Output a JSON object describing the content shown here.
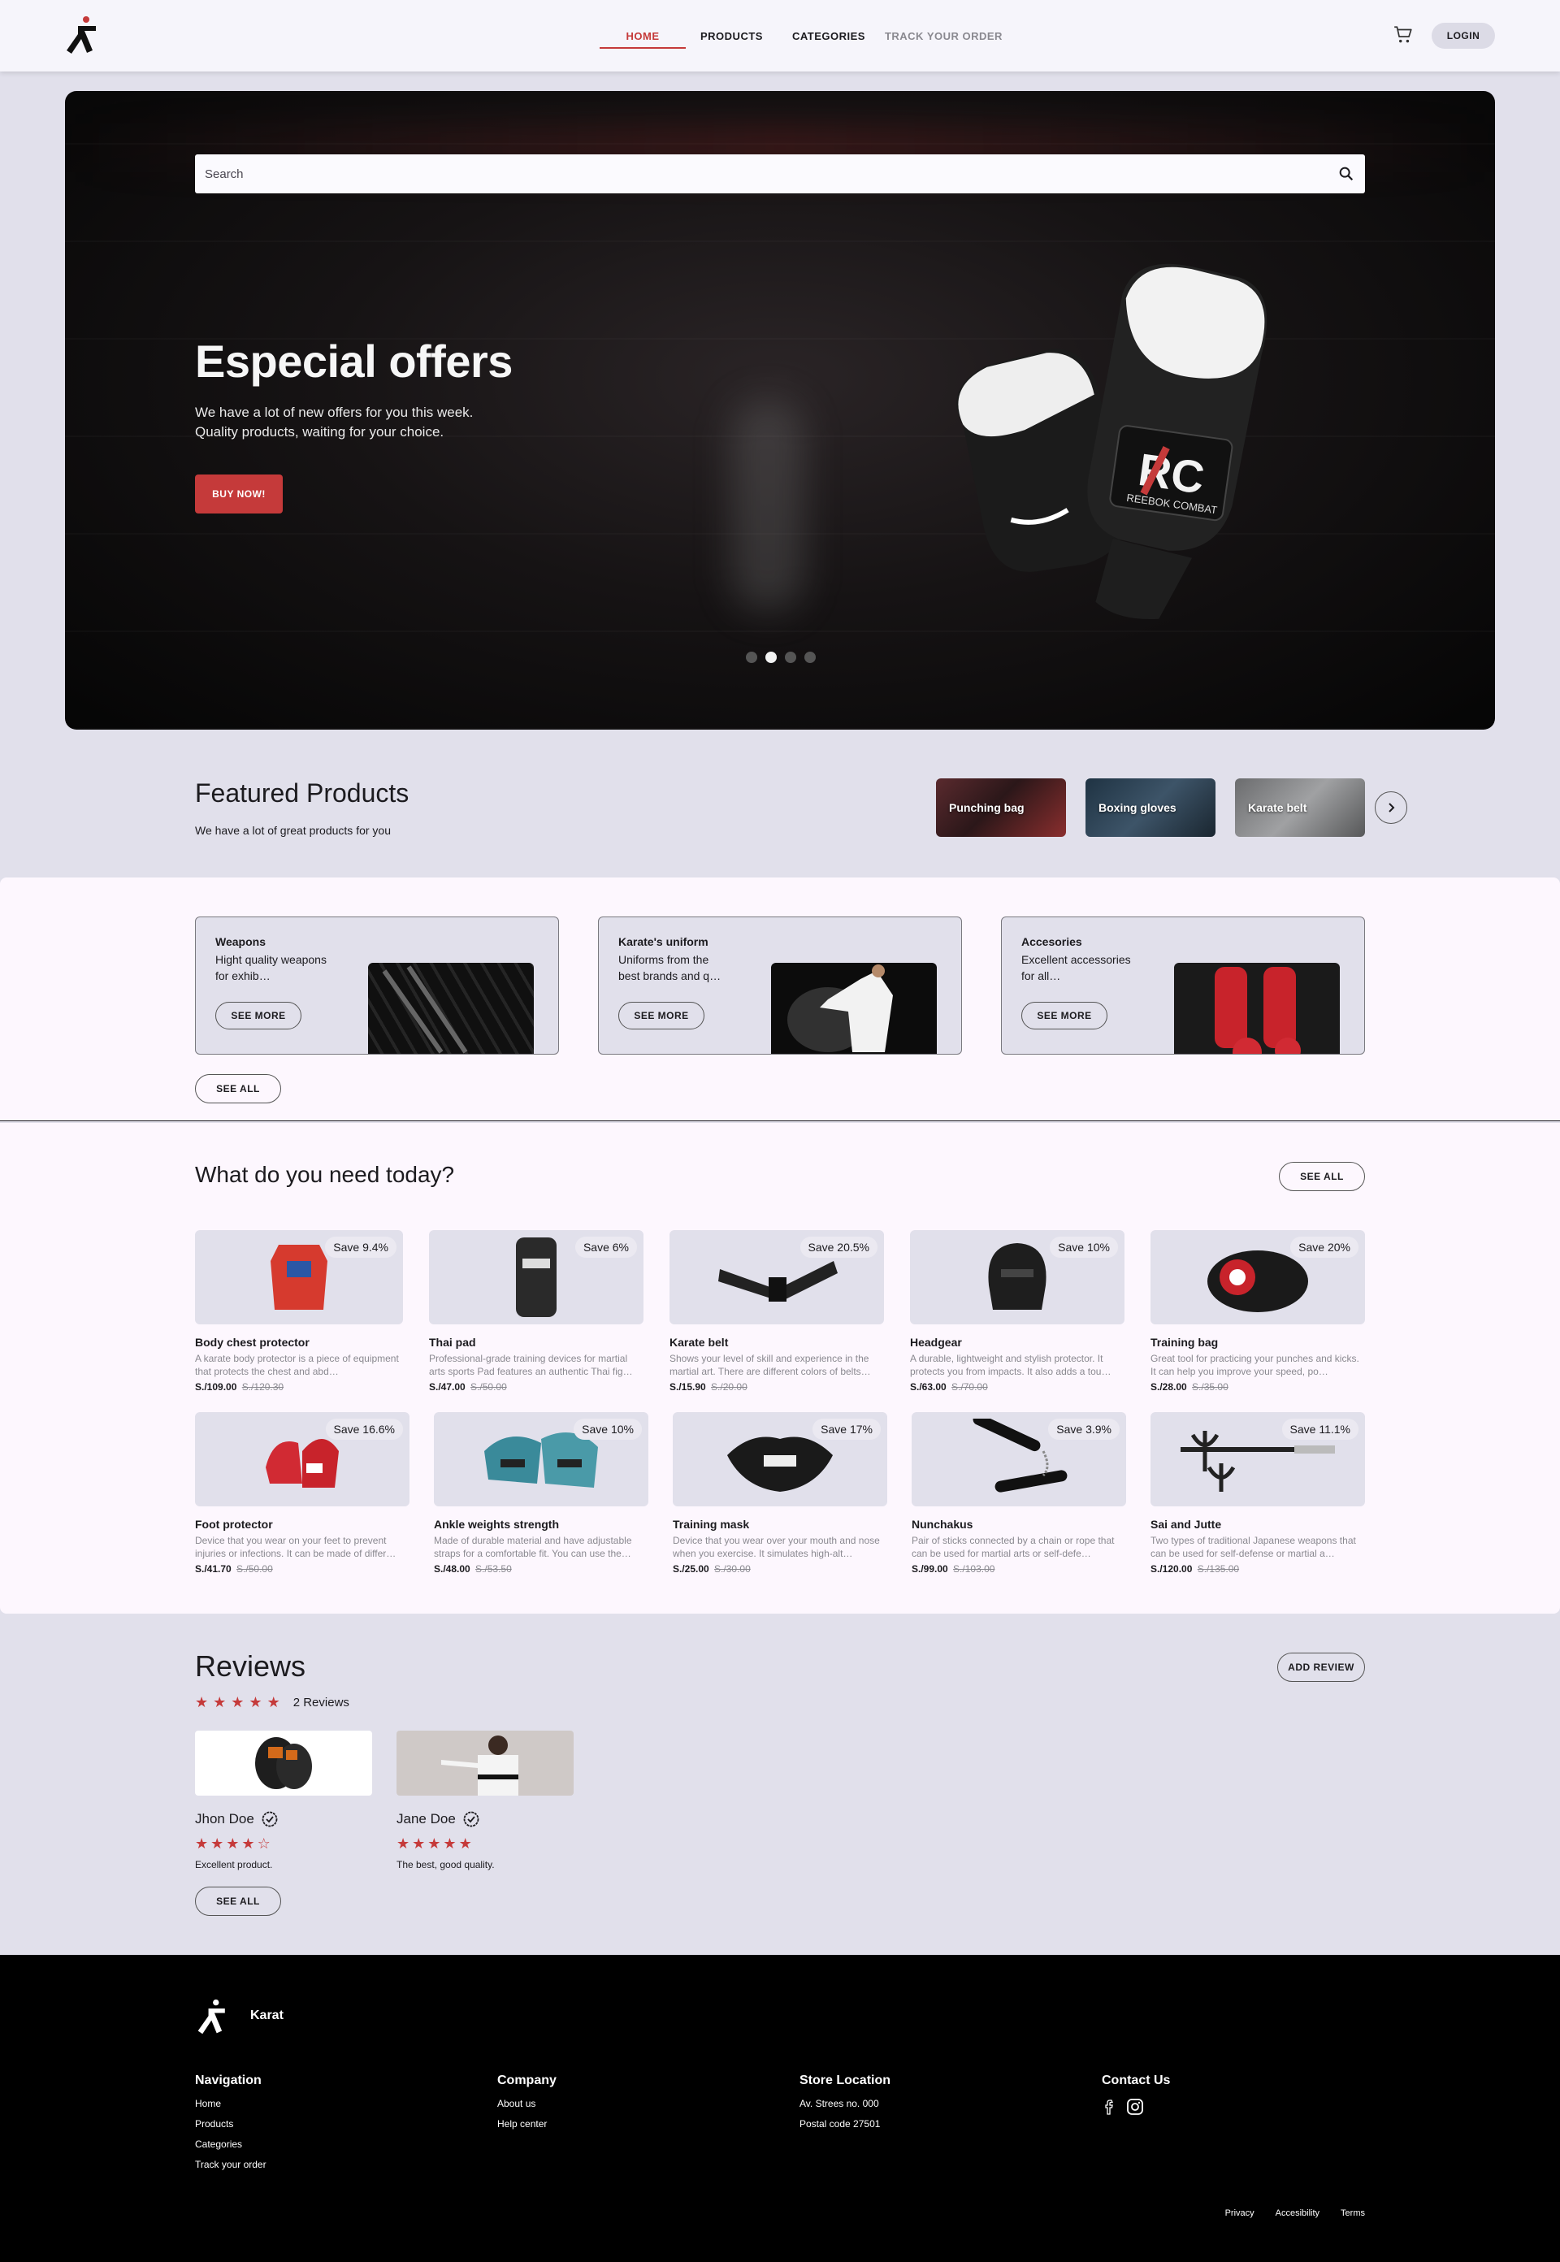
{
  "header": {
    "nav": [
      "HOME",
      "PRODUCTS",
      "CATEGORIES",
      "TRACK YOUR ORDER"
    ],
    "login_label": "LOGIN",
    "icons": [
      "logo-icon",
      "cart-icon"
    ]
  },
  "hero": {
    "search_placeholder": "Search",
    "title": "Especial offers",
    "text_line1": "We have a lot of new offers for you this week.",
    "text_line2": "Quality products, waiting for your choice.",
    "cta_label": "BUY NOW!",
    "slides_total": 4,
    "active_slide": 2,
    "glove_brand": "RC",
    "glove_brand_sub": "REEBOK COMBAT"
  },
  "featured": {
    "title": "Featured Products",
    "subtitle": "We have a lot of great products for you",
    "chips": [
      "Punching bag",
      "Boxing gloves",
      "Karate belt"
    ]
  },
  "categories": {
    "cards": [
      {
        "name": "Weapons",
        "desc": "Hight quality weapons for exhib…",
        "button": "SEE MORE"
      },
      {
        "name": "Karate's uniform",
        "desc": "Uniforms from the best brands and q…",
        "button": "SEE MORE"
      },
      {
        "name": "Accesories",
        "desc": "Excellent accessories for all…",
        "button": "SEE MORE"
      }
    ],
    "see_all_label": "SEE ALL"
  },
  "products": {
    "title": "What do you need today?",
    "see_all_label": "SEE ALL",
    "items": [
      {
        "name": "Body chest protector",
        "desc": "A karate body protector is a piece of equipment that protects the chest and abd…",
        "price": "S./109.00",
        "old_price": "S./120.30",
        "badge": "Save 9.4%"
      },
      {
        "name": "Thai pad",
        "desc": "Professional-grade training devices for martial arts sports Pad features an authentic Thai fig…",
        "price": "S./47.00",
        "old_price": "S./50.00",
        "badge": "Save 6%"
      },
      {
        "name": "Karate belt",
        "desc": "Shows your level of skill and experience in the martial art. There are different colors of belts…",
        "price": "S./15.90",
        "old_price": "S./20.00",
        "badge": "Save 20.5%"
      },
      {
        "name": "Headgear",
        "desc": "A durable, lightweight and stylish protector. It protects you from impacts. It also adds a tou…",
        "price": "S./63.00",
        "old_price": "S./70.00",
        "badge": "Save 10%"
      },
      {
        "name": "Training bag",
        "desc": "Great tool for practicing your punches and kicks. It can help you improve your speed, po…",
        "price": "S./28.00",
        "old_price": "S./35.00",
        "badge": "Save 20%"
      },
      {
        "name": "Foot protector",
        "desc": "Device that you wear on your feet to prevent injuries or infections. It can be made of differ…",
        "price": "S./41.70",
        "old_price": "S./50.00",
        "badge": "Save 16.6%"
      },
      {
        "name": "Ankle weights strength",
        "desc": "Made of durable material and have adjustable straps for a comfortable fit. You can use the…",
        "price": "S./48.00",
        "old_price": "S./53.50",
        "badge": "Save 10%"
      },
      {
        "name": "Training mask",
        "desc": "Device that you wear over your mouth and nose when you exercise. It simulates high-alt…",
        "price": "S./25.00",
        "old_price": "S./30.00",
        "badge": "Save 17%"
      },
      {
        "name": "Nunchakus",
        "desc": "Pair of sticks connected by a chain or rope that can be used for martial arts or self-defe…",
        "price": "S./99.00",
        "old_price": "S./103.00",
        "badge": "Save 3.9%"
      },
      {
        "name": "Sai and Jutte",
        "desc": "Two types of traditional Japanese weapons that can be used for self-defense or martial a…",
        "price": "S./120.00",
        "old_price": "S./135.00",
        "badge": "Save 11.1%"
      }
    ]
  },
  "reviews": {
    "title": "Reviews",
    "add_label": "ADD REVIEW",
    "count_label": "2 Reviews",
    "overall_rating": 5,
    "items": [
      {
        "name": "Jhon Doe",
        "rating": 4,
        "text": "Excellent product."
      },
      {
        "name": "Jane Doe",
        "rating": 5,
        "text": "The best, good quality."
      }
    ],
    "see_all_label": "SEE ALL"
  },
  "footer": {
    "brand": "Karat",
    "navigation": {
      "title": "Navigation",
      "links": [
        "Home",
        "Products",
        "Categories",
        "Track your order"
      ]
    },
    "company": {
      "title": "Company",
      "links": [
        "About us",
        "Help center"
      ]
    },
    "store": {
      "title": "Store Location",
      "lines": [
        "Av. Strees no. 000",
        "Postal code 27501"
      ]
    },
    "contact": {
      "title": "Contact Us",
      "icons": [
        "facebook-icon",
        "instagram-icon"
      ]
    },
    "legal": [
      "Privacy",
      "Accesibility",
      "Terms"
    ]
  },
  "colors": {
    "accent": "#c53a3a",
    "surface": "#e1e0eb",
    "band": "#fdf7fe",
    "footer": "#000000"
  }
}
